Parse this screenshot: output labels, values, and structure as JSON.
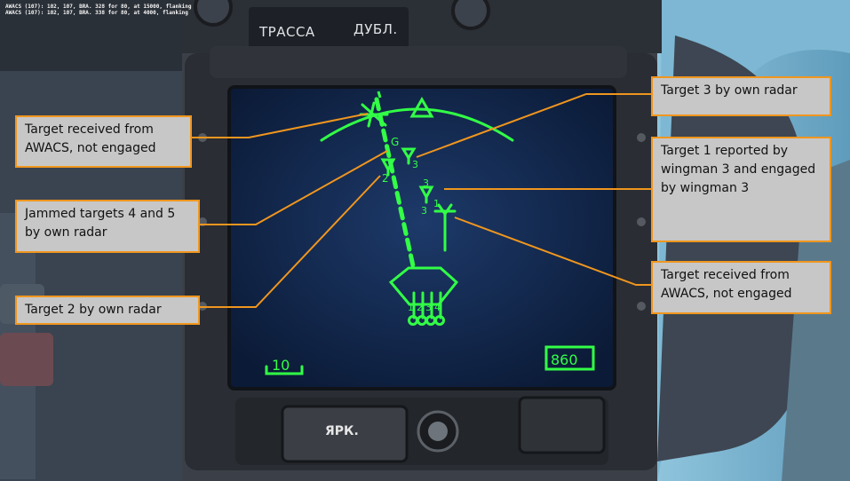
{
  "chat": {
    "line1": "AWACS (107): 102, 107, BRA. 328 for 80, at 15000, flanking",
    "line2": "AWACS (107): 102, 107, BRA. 338 for 80, at 4000, flanking"
  },
  "panel": {
    "label_left": "ТРАССА",
    "label_right": "ДУБЛ.",
    "button_label": "ЯРК."
  },
  "display": {
    "scale_value": "10",
    "range_value": "860",
    "target_marks": {
      "jammed": "G",
      "target2": "2",
      "target3": "3",
      "wingman_num": "3",
      "wingman_target": "1",
      "wingman_engaged_num": "3"
    },
    "missile_digits": [
      "1",
      "2",
      "3",
      "4"
    ]
  },
  "callouts": {
    "awacs_top": "Target received from AWACS, not engaged",
    "jammed": "Jammed targets 4 and 5 by own radar",
    "target2": "Target 2 by own radar",
    "target3": "Target 3 by own radar",
    "wingman": "Target 1 reported by wingman 3 and engaged by wingman 3",
    "awacs_bottom": "Target received from AWACS, not engaged"
  },
  "colors": {
    "hud_green": "#32ff46",
    "callout_border": "#f0961e",
    "callout_fill": "#c7c7c7"
  }
}
